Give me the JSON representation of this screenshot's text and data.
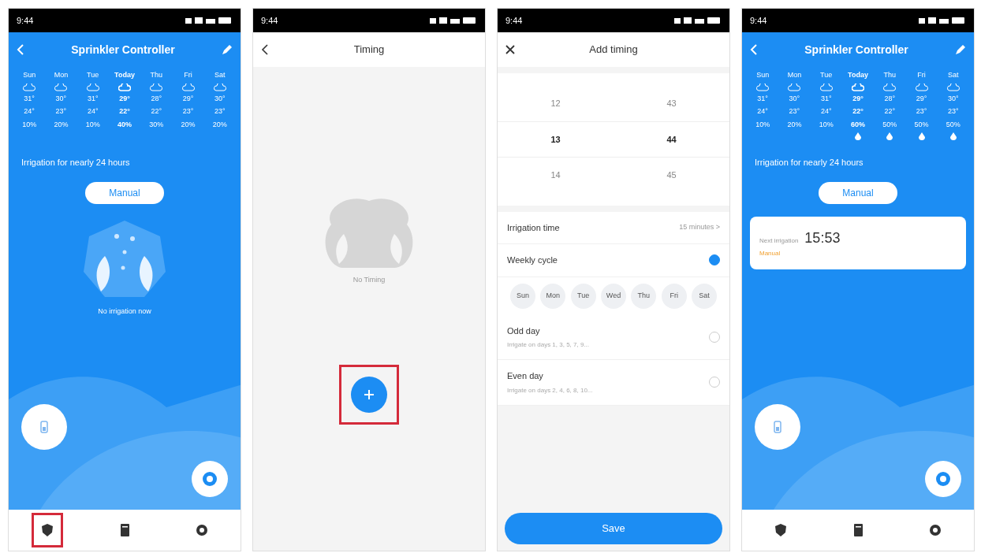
{
  "screens": [
    {
      "kind": "controller",
      "status_time": "9:44",
      "title": "Sprinkler Controller",
      "days": [
        {
          "label": "Sun",
          "high": "31°",
          "low": "24°",
          "rain_chance": "10%",
          "today": false,
          "rain": false
        },
        {
          "label": "Mon",
          "high": "30°",
          "low": "23°",
          "rain_chance": "20%",
          "today": false,
          "rain": false
        },
        {
          "label": "Tue",
          "high": "31°",
          "low": "24°",
          "rain_chance": "10%",
          "today": false,
          "rain": false
        },
        {
          "label": "Today",
          "high": "29°",
          "low": "22°",
          "rain_chance": "40%",
          "today": true,
          "rain": false
        },
        {
          "label": "Thu",
          "high": "28°",
          "low": "22°",
          "rain_chance": "30%",
          "today": false,
          "rain": false
        },
        {
          "label": "Fri",
          "high": "29°",
          "low": "23°",
          "rain_chance": "20%",
          "today": false,
          "rain": false
        },
        {
          "label": "Sat",
          "high": "30°",
          "low": "23°",
          "rain_chance": "20%",
          "today": false,
          "rain": false
        }
      ],
      "irrigation_text": "Irrigation for nearly 24 hours",
      "manual_label": "Manual",
      "idle_text": "No irrigation now",
      "nav": [
        {
          "highlighted": true
        },
        {
          "highlighted": false
        },
        {
          "highlighted": false
        }
      ]
    },
    {
      "kind": "timing",
      "status_time": "9:44",
      "title": "Timing",
      "empty_text": "No Timing",
      "add_highlighted": true
    },
    {
      "kind": "add_timing",
      "status_time": "9:44",
      "title": "Add timing",
      "picker": [
        {
          "hour": "12",
          "minute": "43",
          "selected": false
        },
        {
          "hour": "13",
          "minute": "44",
          "selected": true
        },
        {
          "hour": "14",
          "minute": "45",
          "selected": false
        }
      ],
      "irrigation_label": "Irrigation time",
      "irrigation_value": "15 minutes >",
      "weekly_label": "Weekly cycle",
      "weekly_on": true,
      "weekdays": [
        "Sun",
        "Mon",
        "Tue",
        "Wed",
        "Thu",
        "Fri",
        "Sat"
      ],
      "options": [
        {
          "label": "Odd day",
          "hint": "Irrigate on days 1, 3, 5, 7, 9...",
          "checked": false
        },
        {
          "label": "Even day",
          "hint": "Irrigate on days 2, 4, 6, 8, 10...",
          "checked": false
        }
      ],
      "save_label": "Save"
    },
    {
      "kind": "controller",
      "status_time": "9:44",
      "title": "Sprinkler Controller",
      "days": [
        {
          "label": "Sun",
          "high": "31°",
          "low": "24°",
          "rain_chance": "10%",
          "today": false,
          "rain": false
        },
        {
          "label": "Mon",
          "high": "30°",
          "low": "23°",
          "rain_chance": "20%",
          "today": false,
          "rain": false
        },
        {
          "label": "Tue",
          "high": "31°",
          "low": "24°",
          "rain_chance": "10%",
          "today": false,
          "rain": false
        },
        {
          "label": "Today",
          "high": "29°",
          "low": "22°",
          "rain_chance": "60%",
          "today": true,
          "rain": true
        },
        {
          "label": "Thu",
          "high": "28°",
          "low": "22°",
          "rain_chance": "50%",
          "today": false,
          "rain": true
        },
        {
          "label": "Fri",
          "high": "29°",
          "low": "23°",
          "rain_chance": "50%",
          "today": false,
          "rain": true
        },
        {
          "label": "Sat",
          "high": "30°",
          "low": "23°",
          "rain_chance": "50%",
          "today": false,
          "rain": true
        }
      ],
      "irrigation_text": "Irrigation for nearly 24 hours",
      "manual_label": "Manual",
      "timer": {
        "label": "Next irrigation",
        "time": "15:53",
        "note": "Manual"
      },
      "nav": [
        {
          "highlighted": false
        },
        {
          "highlighted": false
        },
        {
          "highlighted": false
        }
      ]
    }
  ]
}
